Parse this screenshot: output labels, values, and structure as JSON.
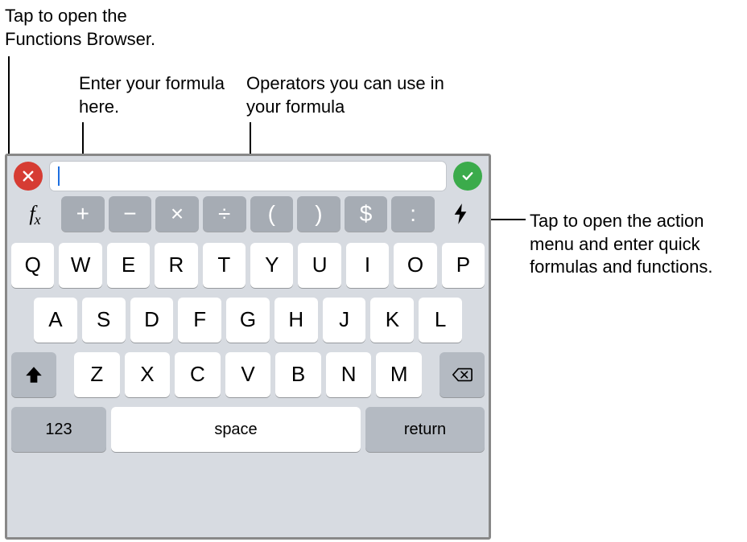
{
  "callouts": {
    "functions_browser": "Tap to open the Functions Browser.",
    "enter_formula": "Enter your formula here.",
    "operators_hint": "Operators you can use in your formula",
    "action_menu": "Tap to open the action menu and enter quick formulas and functions."
  },
  "formula_bar": {
    "cancel_label": "Cancel",
    "confirm_label": "Confirm",
    "value": "",
    "placeholder": ""
  },
  "fx_label": {
    "f": "f",
    "x": "x"
  },
  "operators": [
    "+",
    "−",
    "×",
    "÷",
    "(",
    ")",
    "$",
    ":"
  ],
  "keyboard": {
    "row1": [
      "Q",
      "W",
      "E",
      "R",
      "T",
      "Y",
      "U",
      "I",
      "O",
      "P"
    ],
    "row2": [
      "A",
      "S",
      "D",
      "F",
      "G",
      "H",
      "J",
      "K",
      "L"
    ],
    "row3": [
      "Z",
      "X",
      "C",
      "V",
      "B",
      "N",
      "M"
    ],
    "numbers_key": "123",
    "space_key": "space",
    "return_key": "return"
  }
}
